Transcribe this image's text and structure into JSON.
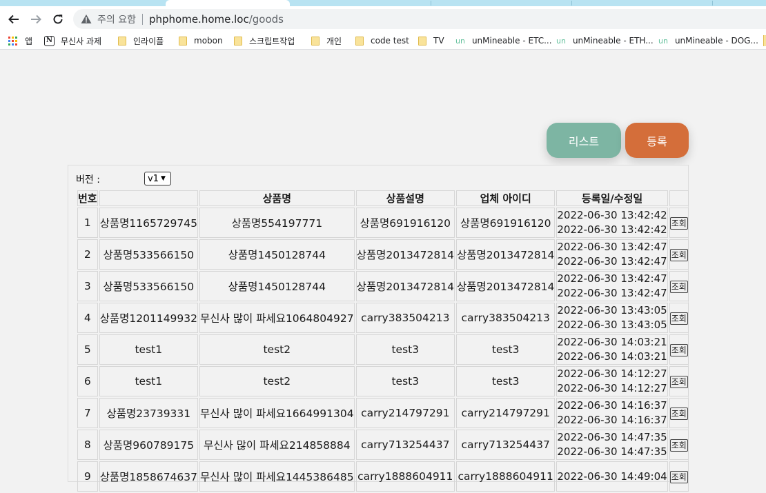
{
  "browser": {
    "security_label": "주의 요함",
    "url_host": "phphome.home.loc",
    "url_path": "/goods",
    "bookmarks": [
      {
        "label": "앱",
        "icon": "apps-grid-icon"
      },
      {
        "label": "무신사 과제",
        "icon": "notion-icon"
      },
      {
        "label": "인라이플",
        "icon": "folder-icon"
      },
      {
        "label": "mobon",
        "icon": "folder-icon"
      },
      {
        "label": "스크립트작업",
        "icon": "folder-icon"
      },
      {
        "label": "개인",
        "icon": "folder-icon"
      },
      {
        "label": "code test",
        "icon": "folder-icon"
      },
      {
        "label": "TV",
        "icon": "folder-icon"
      },
      {
        "label": "unMineable - ETC...",
        "prefix": "un"
      },
      {
        "label": "unMineable - ETH...",
        "prefix": "un"
      },
      {
        "label": "unMineable - DOG...",
        "prefix": "un"
      }
    ]
  },
  "actions": {
    "list_label": "리스트",
    "list_color": "#7db5a3",
    "register_label": "등록",
    "register_color": "#d46e3a"
  },
  "version": {
    "label": "버전 :",
    "selected": "v1"
  },
  "table": {
    "headers": [
      "번호",
      "",
      "상품명",
      "상품설명",
      "업체 아이디",
      "등록일/수정일",
      ""
    ],
    "view_label": "조회",
    "rows": [
      {
        "no": "1",
        "code": "상품명1165729745",
        "name": "상품명554197771",
        "desc": "상품명691916120",
        "vendor": "상품명691916120",
        "created": "2022-06-30 13:42:42",
        "updated": "2022-06-30 13:42:42"
      },
      {
        "no": "2",
        "code": "상품명533566150",
        "name": "상품명1450128744",
        "desc": "상품명2013472814",
        "vendor": "상품명2013472814",
        "created": "2022-06-30 13:42:47",
        "updated": "2022-06-30 13:42:47"
      },
      {
        "no": "3",
        "code": "상품명533566150",
        "name": "상품명1450128744",
        "desc": "상품명2013472814",
        "vendor": "상품명2013472814",
        "created": "2022-06-30 13:42:47",
        "updated": "2022-06-30 13:42:47"
      },
      {
        "no": "4",
        "code": "상품명1201149932",
        "name": "무신사 많이 파세요1064804927",
        "desc": "carry383504213",
        "vendor": "carry383504213",
        "created": "2022-06-30 13:43:05",
        "updated": "2022-06-30 13:43:05"
      },
      {
        "no": "5",
        "code": "test1",
        "name": "test2",
        "desc": "test3",
        "vendor": "test3",
        "created": "2022-06-30 14:03:21",
        "updated": "2022-06-30 14:03:21"
      },
      {
        "no": "6",
        "code": "test1",
        "name": "test2",
        "desc": "test3",
        "vendor": "test3",
        "created": "2022-06-30 14:12:27",
        "updated": "2022-06-30 14:12:27"
      },
      {
        "no": "7",
        "code": "상품명23739331",
        "name": "무신사 많이 파세요1664991304",
        "desc": "carry214797291",
        "vendor": "carry214797291",
        "created": "2022-06-30 14:16:37",
        "updated": "2022-06-30 14:16:37"
      },
      {
        "no": "8",
        "code": "상품명960789175",
        "name": "무신사 많이 파세요214858884",
        "desc": "carry713254437",
        "vendor": "carry713254437",
        "created": "2022-06-30 14:47:35",
        "updated": "2022-06-30 14:47:35"
      },
      {
        "no": "9",
        "code": "상품명1858674637",
        "name": "무신사 많이 파세요1445386485",
        "desc": "carry1888604911",
        "vendor": "carry1888604911",
        "created": "2022-06-30 14:49:04",
        "updated": ""
      }
    ]
  }
}
